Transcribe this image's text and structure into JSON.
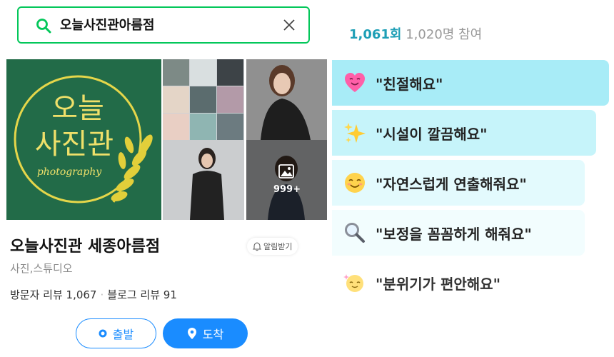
{
  "search": {
    "query": "오늘사진관아름점"
  },
  "gallery": {
    "logo_line1": "오늘",
    "logo_line2": "사진관",
    "logo_script": "photography",
    "more_count": "999+"
  },
  "place": {
    "name": "오늘사진관 세종아름점",
    "category": "사진,스튜디오",
    "visitor_reviews": "방문자 리뷰 1,067",
    "blog_reviews": "블로그 리뷰 91",
    "alarm_label": "알림받기"
  },
  "actions": {
    "start_label": "출발",
    "arrive_label": "도착"
  },
  "stats": {
    "count": "1,061회",
    "participants": "1,020명 참여"
  },
  "keywords": [
    {
      "icon": "heart-face-icon",
      "label": "\"친절해요\""
    },
    {
      "icon": "sparkles-icon",
      "label": "\"시설이 깔끔해요\""
    },
    {
      "icon": "smiling-face-icon",
      "label": "\"자연스럽게 연출해줘요\""
    },
    {
      "icon": "magnifier-icon",
      "label": "\"보정을 꼼꼼하게 해줘요\""
    },
    {
      "icon": "relieved-face-icon",
      "label": "\"분위기가 편안해요\""
    }
  ],
  "colors": {
    "accent_green": "#03c75a",
    "accent_blue": "#1a8cff",
    "stat_teal": "#1e9fb6",
    "logo_green": "#226b48"
  }
}
